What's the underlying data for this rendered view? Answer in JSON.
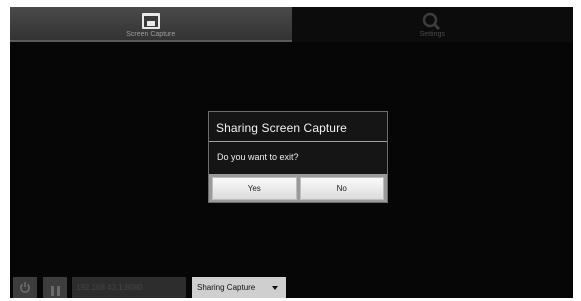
{
  "tabs": [
    {
      "label": "Screen Capture",
      "icon": "screen-capture-icon",
      "active": true
    },
    {
      "label": "Settings",
      "icon": "search-settings-icon",
      "active": false
    }
  ],
  "dialog": {
    "title": "Sharing Screen Capture",
    "message": "Do you want to exit?",
    "yes_label": "Yes",
    "no_label": "No"
  },
  "bottom_bar": {
    "power_icon": "power-icon",
    "pause_icon": "pause-icon",
    "ip_address": "192.168.43.1:8080",
    "mode_select": "Sharing Capture"
  },
  "colors": {
    "background": "#060606",
    "dialog_background": "#151515",
    "button_bar": "#9a9a9a"
  }
}
